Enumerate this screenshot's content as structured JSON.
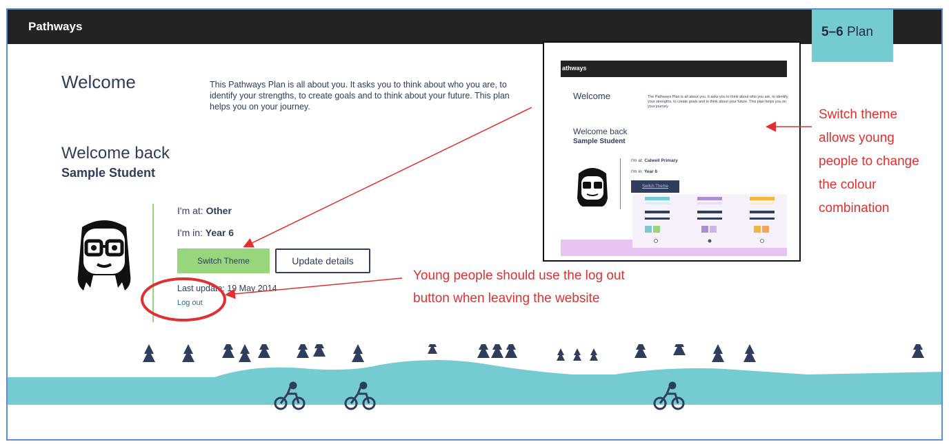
{
  "header": {
    "brand": "Pathways",
    "plan_number": "5–6",
    "plan_label": "Plan"
  },
  "main": {
    "welcome_title": "Welcome",
    "intro_text": "This Pathways Plan is all about you. It asks you to think about who you are, to identify your strengths, to create goals and to think about your future. This plan helps you on your journey.",
    "welcome_back": "Welcome back",
    "student_name": "Sample Student",
    "at_label": "I'm at:",
    "at_value": "Other",
    "in_label": "I'm in:",
    "in_value": "Year 6",
    "switch_theme": "Switch Theme",
    "update_details": "Update details",
    "last_update": "Last update: 19 May 2014",
    "log_out": "Log out"
  },
  "annotations": {
    "logout_note": "Young people should use the log out button when leaving the website",
    "theme_note": "Switch theme allows young people to change the colour combination",
    "color": "#e03030"
  },
  "inset": {
    "brand": "athways",
    "welcome_title": "Welcome",
    "intro_text": "The Pathways Plan is all about you. It asks you to think about who you are, to identify your strengths, to create goals and to think about your future. This plan helps you on your journey.",
    "welcome_back": "Welcome back",
    "student_name": "Sample Student",
    "at_label": "I'm at:",
    "at_value": "Calwell Primary",
    "in_label": "I'm in:",
    "in_value": "Year 6",
    "switch_theme": "Switch Theme",
    "theme_swatches": [
      "#74cbd1",
      "#97d67c",
      "#a98fd4",
      "#c9b8e6",
      "#f0b63d",
      "#f7a35c"
    ]
  },
  "colors": {
    "navy": "#2e3e5c",
    "teal": "#74cbd1",
    "green": "#97d67c",
    "dark": "#232323"
  }
}
